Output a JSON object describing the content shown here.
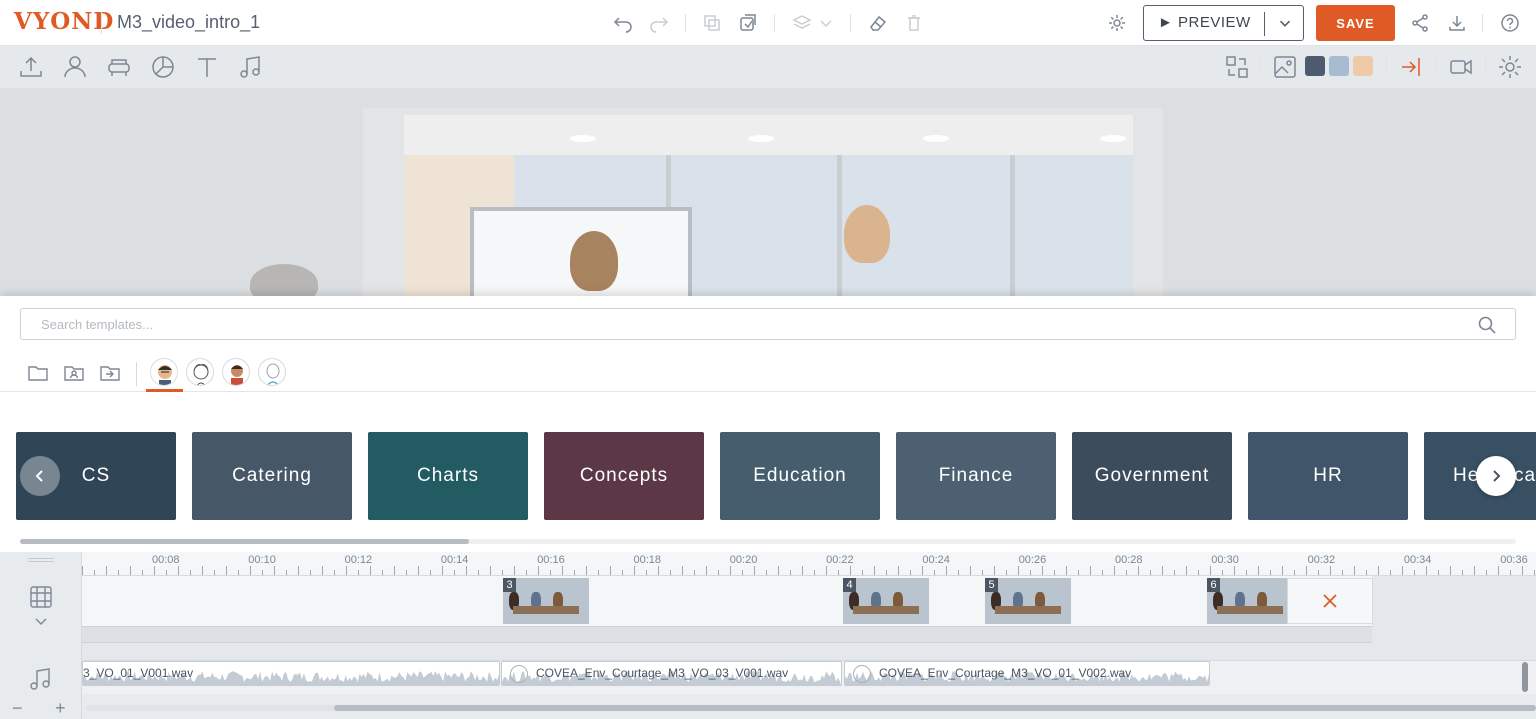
{
  "app": {
    "logo_text": "VYOND",
    "project_title": "M3_video_intro_1"
  },
  "topbar": {
    "preview_label": "► PREVIEW",
    "save_label": "SAVE"
  },
  "palette": {
    "accent": "#e05a25",
    "swatches": [
      "#4d5a70",
      "#a7bbd3",
      "#f0c9a8"
    ]
  },
  "templates": {
    "search_placeholder": "Search templates...",
    "categories": [
      {
        "label": "CS",
        "color": "#3b5a6e"
      },
      {
        "label": "Catering",
        "color": "#6b8196"
      },
      {
        "label": "Charts",
        "color": "#1e8a8a"
      },
      {
        "label": "Concepts",
        "color": "#9c3a4a"
      },
      {
        "label": "Education",
        "color": "#6b8fa3"
      },
      {
        "label": "Finance",
        "color": "#7b95ab"
      },
      {
        "label": "Government",
        "color": "#55687c"
      },
      {
        "label": "HR",
        "color": "#5d7d98"
      },
      {
        "label": "Healthcare",
        "color": "#4e6f88"
      }
    ]
  },
  "timeline": {
    "ruler_labels": [
      "00:08",
      "00:10",
      "00:12",
      "00:14",
      "00:16",
      "00:18",
      "00:20",
      "00:22",
      "00:24",
      "00:26",
      "00:28",
      "00:30",
      "00:32",
      "00:34",
      "00:36"
    ],
    "scenes": [
      {
        "number": "3"
      },
      {
        "number": "4"
      },
      {
        "number": "5"
      },
      {
        "number": "6"
      }
    ],
    "audio_clips": [
      {
        "name": "3_VO_01_V001.wav"
      },
      {
        "name": "COVEA_Env_Courtage_M3_VO_03_V001.wav"
      },
      {
        "name": "COVEA_Env_Courtage_M3_VO_01_V002.wav"
      }
    ],
    "zoom_out_label": "−",
    "zoom_in_label": "+"
  }
}
